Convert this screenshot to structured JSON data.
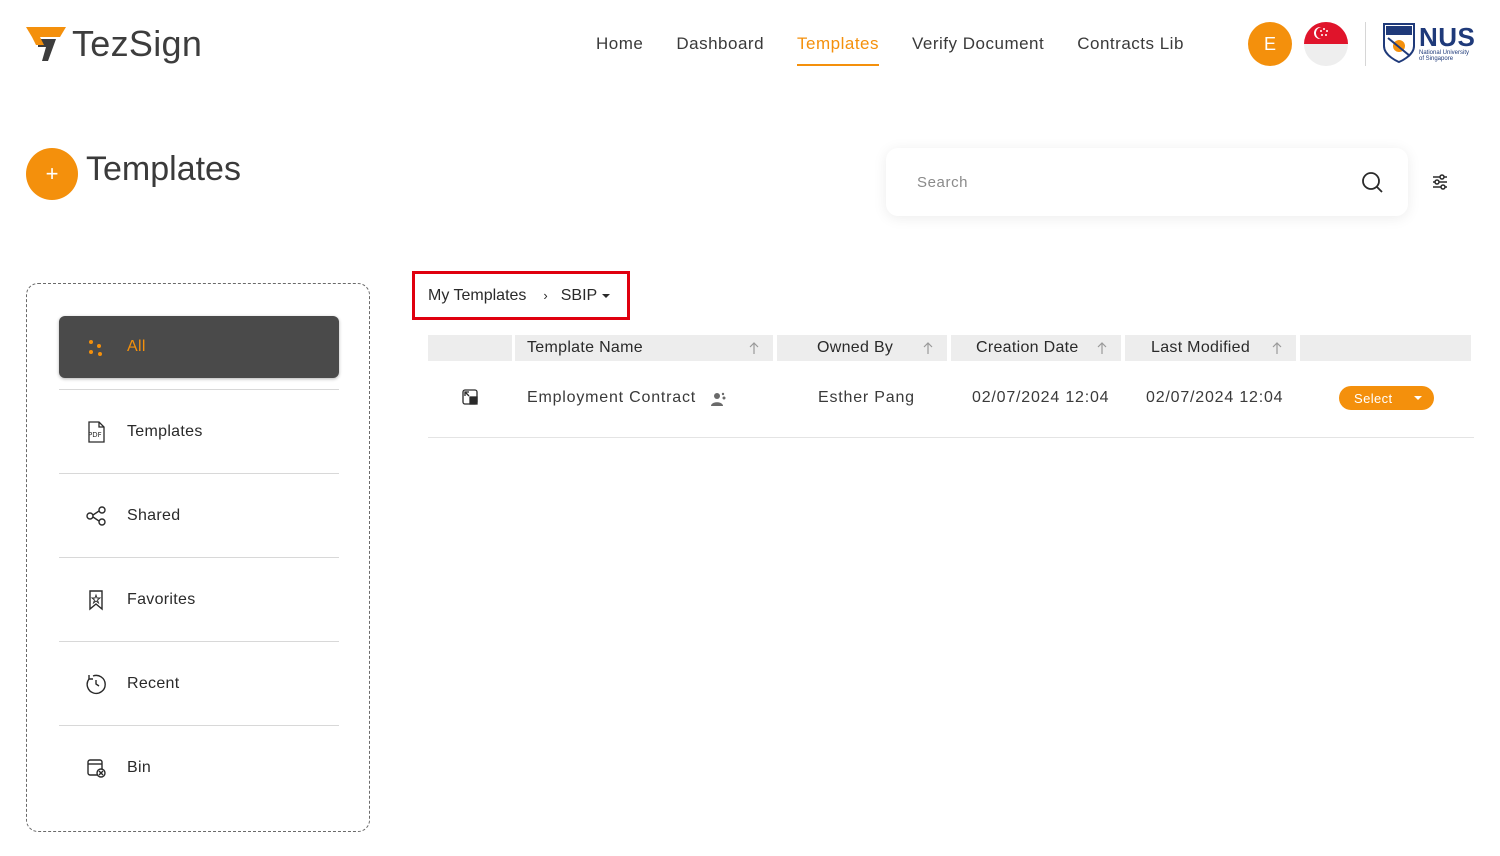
{
  "app": {
    "brand": "TezSign",
    "brand_color": "#f4900c"
  },
  "nav": {
    "items": [
      {
        "label": "Home"
      },
      {
        "label": "Dashboard"
      },
      {
        "label": "Templates",
        "active": true
      },
      {
        "label": "Verify Document"
      },
      {
        "label": "Contracts Lib"
      }
    ]
  },
  "user": {
    "avatar_initial": "E",
    "flag": "singapore-flag-icon",
    "org_logo": "NUS",
    "org_subtitle_1": "National University",
    "org_subtitle_2": "of Singapore"
  },
  "page": {
    "add_label": "+",
    "title": "Templates"
  },
  "search": {
    "placeholder": "Search",
    "value": ""
  },
  "sidebar": {
    "items": [
      {
        "label": "All",
        "icon": "dots-icon",
        "active": true
      },
      {
        "label": "Templates",
        "icon": "pdf-icon"
      },
      {
        "label": "Shared",
        "icon": "share-icon"
      },
      {
        "label": "Favorites",
        "icon": "bookmark-star-icon"
      },
      {
        "label": "Recent",
        "icon": "history-icon"
      },
      {
        "label": "Bin",
        "icon": "bin-icon"
      }
    ]
  },
  "breadcrumb": {
    "root": "My Templates",
    "separator": "›",
    "current": "SBIP"
  },
  "table": {
    "columns": [
      "Template Name",
      "Owned By",
      "Creation Date",
      "Last Modified"
    ],
    "rows": [
      {
        "template_name": "Employment Contract",
        "owned_by": "Esther Pang",
        "creation_date": "02/07/2024 12:04",
        "last_modified": "02/07/2024 12:04",
        "action": "Select"
      }
    ]
  }
}
